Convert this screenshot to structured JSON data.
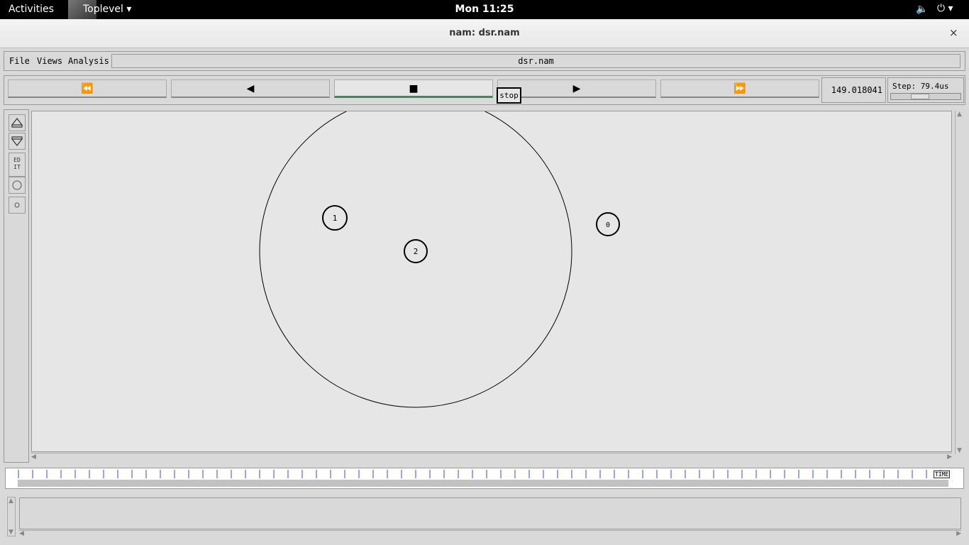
{
  "topbar": {
    "activities": "Activities",
    "app_name": "Toplevel ▾",
    "clock": "Mon 11:25",
    "volume_icon": "🔈",
    "power_icon": "⏻ ▾"
  },
  "window": {
    "title": "nam: dsr.nam",
    "close": "×"
  },
  "menu": {
    "file": "File",
    "views": "Views",
    "analysis": "Analysis",
    "filename": "dsr.nam"
  },
  "controls": {
    "rewind": "⏪",
    "back": "◀",
    "stop": "■",
    "play": "▶",
    "fastforward": "⏩",
    "tooltip": "stop",
    "time": "149.018041",
    "step": "Step: 79.4us"
  },
  "sidebar": {
    "edit": "ED\nIT"
  },
  "nodes": [
    {
      "label": "1"
    },
    {
      "label": "2"
    },
    {
      "label": "0"
    }
  ],
  "timeline": {
    "label": "TIME"
  }
}
